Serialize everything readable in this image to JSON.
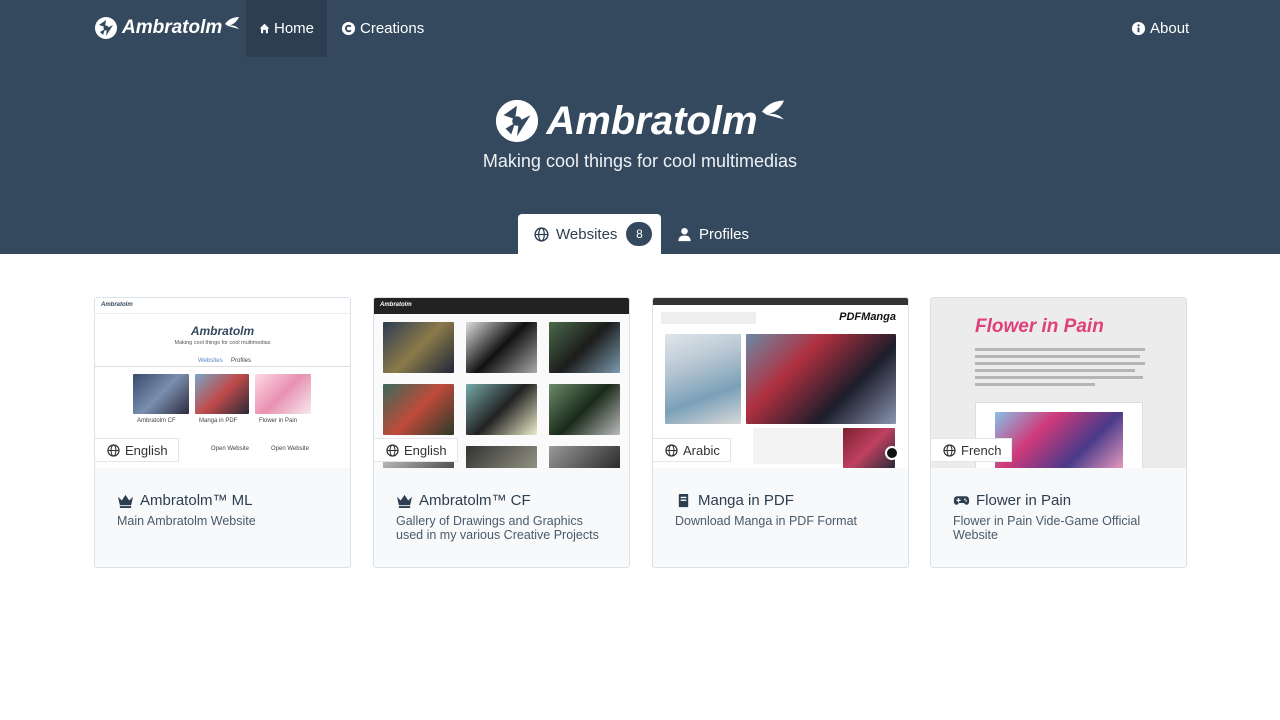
{
  "navbar": {
    "brand": "Ambratolm",
    "items": [
      {
        "label": "Home",
        "icon": "home-icon",
        "active": true
      },
      {
        "label": "Creations",
        "icon": "copyright-icon",
        "active": false
      }
    ],
    "about": {
      "label": "About",
      "icon": "info-icon"
    }
  },
  "hero": {
    "title": "Ambratolm",
    "subtitle": "Making cool things for cool multimedias"
  },
  "tabs": [
    {
      "label": "Websites",
      "icon": "globe-icon",
      "badge": "8",
      "active": true
    },
    {
      "label": "Profiles",
      "icon": "user-icon",
      "active": false
    }
  ],
  "cards": [
    {
      "title": "Ambratolm™ ML",
      "description": "Main Ambratolm Website",
      "language": "English",
      "icon": "crown-icon"
    },
    {
      "title": "Ambratolm™ CF",
      "description": "Gallery of Drawings and Graphics used in my various Creative Projects",
      "language": "English",
      "icon": "crown-icon"
    },
    {
      "title": "Manga in PDF",
      "description": "Download Manga in PDF Format",
      "language": "Arabic",
      "icon": "book-icon"
    },
    {
      "title": "Flower in Pain",
      "description": "Flower in Pain Vide-Game Official Website",
      "language": "French",
      "icon": "gamepad-icon"
    }
  ],
  "thumbs": {
    "ml_title": "Ambratolm",
    "ml_sub": "Making cool things for cool multimedias",
    "ml_tabs": [
      "Websites",
      "Profiles"
    ],
    "ml_cards": [
      "Ambratolm CF",
      "Manga in PDF",
      "Flower in Pain"
    ],
    "ml_btn": "Open Website",
    "pdf_logo": "PDFManga",
    "fip_title": "Flower in Pain"
  },
  "colors": {
    "hero_bg": "#34495e",
    "active_nav": "#2c3e50",
    "fip_pink": "#e0407a"
  }
}
